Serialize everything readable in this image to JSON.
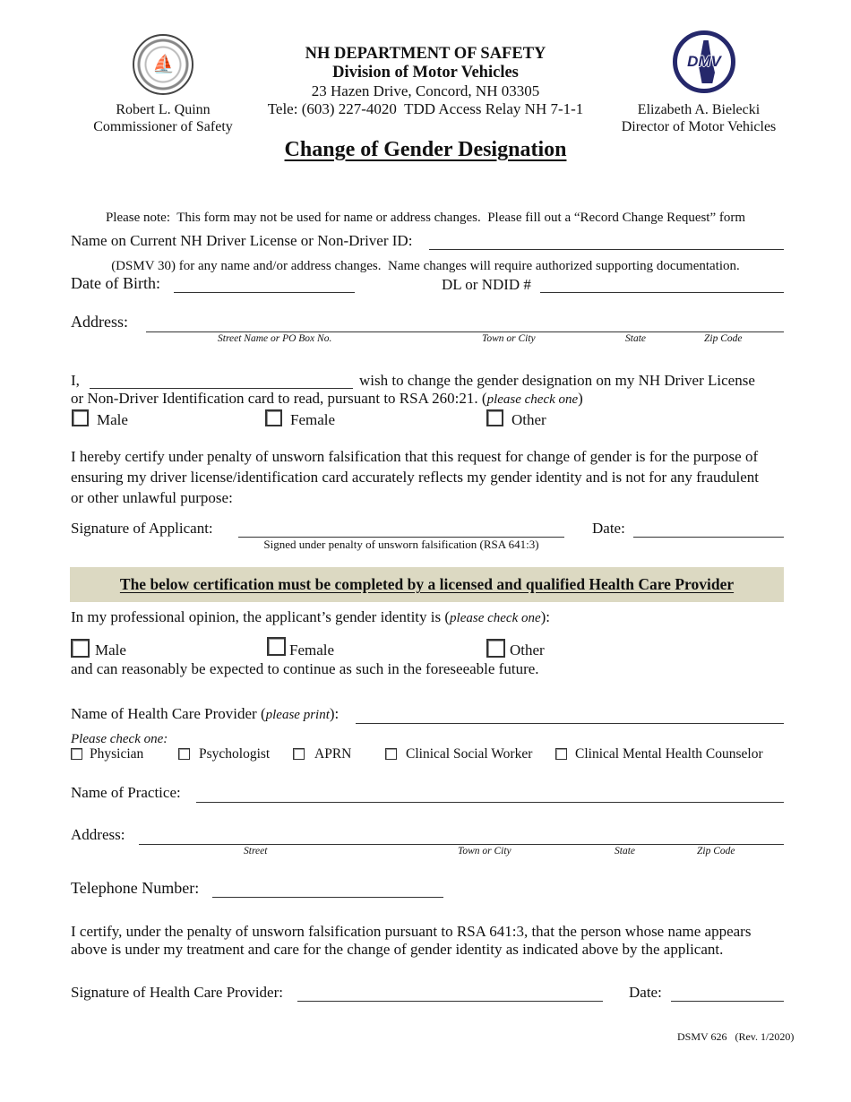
{
  "header": {
    "left_person": {
      "name": "Robert L. Quinn",
      "title": "Commissioner of Safety",
      "logo": "nh-state-seal-icon"
    },
    "right_person": {
      "name": "Elizabeth A. Bielecki",
      "title": "Director of Motor Vehicles",
      "logo": "dmv-logo-icon",
      "logo_text": "DMV"
    },
    "department": "NH DEPARTMENT OF SAFETY",
    "division": "Division of Motor Vehicles",
    "address": "23 Hazen Drive, Concord, NH 03305",
    "phone": "Tele: (603) 227-4020  TDD Access Relay NH 7-1-1"
  },
  "form_title": "Change of Gender Designation",
  "note": {
    "line1": "Please note:  This form may not be used for name or address changes.  Please fill out a “Record Change Request” form",
    "line2": "(DSMV 30) for any name and/or address changes.  Name changes will require authorized supporting documentation."
  },
  "applicant": {
    "name_label": "Name on Current NH Driver License or Non-Driver ID:",
    "name_value": "",
    "dob_label": "Date of Birth:",
    "dob_value": "",
    "dl_label": "DL or NDID #",
    "dl_value": "",
    "address_label": "Address:",
    "address_value": "",
    "address_parts": [
      "Street Name or PO Box No.",
      "Town or City",
      "State",
      "Zip Code"
    ],
    "request_prefix": "I,",
    "request_name_value": "",
    "request_text1": "wish to change the gender designation on my NH Driver License",
    "request_text2": "or Non-Driver Identification card to read, pursuant to RSA 260:21. (",
    "request_hint": "please check one",
    "request_close": ")",
    "gender_options": [
      {
        "label": "Male",
        "checked": false
      },
      {
        "label": "Female",
        "checked": false
      },
      {
        "label": "Other",
        "checked": false
      }
    ],
    "certify_line1": "I hereby certify under penalty of unsworn falsification that this request for change of gender is for the purpose of",
    "certify_line2": "ensuring my driver license/identification card accurately reflects my gender identity and is not for any fraudulent",
    "certify_line3": "or other unlawful purpose:",
    "signature_label": "Signature of Applicant:",
    "signature_note": "Signed under penalty of unsworn falsification (RSA 641:3)",
    "date_label": "Date:",
    "date_value": ""
  },
  "provider": {
    "banner": "The below certification must be completed by a licensed and qualified Health Care Provider",
    "opinion_prefix": "In my professional opinion, the applicant’s gender identity is (",
    "opinion_hint": "please check one",
    "opinion_close": "):",
    "gender_options": [
      {
        "label": "Male",
        "checked": false
      },
      {
        "label": "Female",
        "checked": false
      },
      {
        "label": "Other",
        "checked": false
      }
    ],
    "continue_text": "and can reasonably be expected to continue as such in the foreseeable future.",
    "name_label_prefix": "Name of Health Care Provider (",
    "name_label_hint": "please print",
    "name_label_close": "):",
    "name_value": "",
    "check_one": "Please check one:",
    "types": [
      {
        "label": "Physician",
        "checked": false
      },
      {
        "label": "Psychologist",
        "checked": false
      },
      {
        "label": "APRN",
        "checked": false
      },
      {
        "label": "Clinical Social Worker",
        "checked": false
      },
      {
        "label": "Clinical Mental Health Counselor",
        "checked": false
      }
    ],
    "practice_label": "Name of Practice:",
    "practice_value": "",
    "address_label": "Address:",
    "address_value": "",
    "address_parts": [
      "Street",
      "Town or City",
      "State",
      "Zip Code"
    ],
    "phone_label": "Telephone Number:",
    "phone_value": "",
    "certify_line1": "I certify, under the penalty of unsworn falsification pursuant to RSA 641:3, that the person whose name appears",
    "certify_line2": "above is under my treatment and care for the change of gender identity as indicated above by the applicant.",
    "signature_label": "Signature of Health Care Provider:",
    "date_label": "Date:",
    "date_value": ""
  },
  "footer": {
    "form_id": "DSMV 626   (Rev. 1/2020)"
  },
  "colors": {
    "banner_bg": "#dcd9c2",
    "dmv_blue": "#25286b"
  }
}
